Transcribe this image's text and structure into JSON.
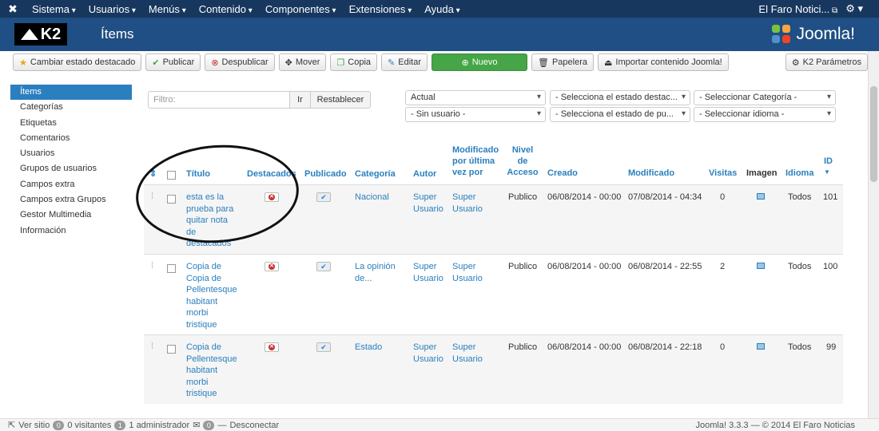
{
  "topbar": {
    "menu": [
      "Sistema",
      "Usuarios",
      "Menús",
      "Contenido",
      "Componentes",
      "Extensiones",
      "Ayuda"
    ],
    "site_name": "El Faro Notici..."
  },
  "header": {
    "logo_text": "K2",
    "title": "Ítems",
    "brand": "Joomla!"
  },
  "toolbar": {
    "featured": "Cambiar estado destacado",
    "publish": "Publicar",
    "unpublish": "Despublicar",
    "move": "Mover",
    "copy": "Copia",
    "edit": "Editar",
    "new": "Nuevo",
    "trash": "Papelera",
    "import": "Importar contenido Joomla!",
    "params": "K2 Parámetros"
  },
  "sidebar": {
    "items": [
      "Ítems",
      "Categorías",
      "Etiquetas",
      "Comentarios",
      "Usuarios",
      "Grupos de usuarios",
      "Campos extra",
      "Campos extra Grupos",
      "Gestor Multimedia",
      "Información"
    ]
  },
  "filters": {
    "search_placeholder": "Filtro:",
    "go": "Ir",
    "reset": "Restablecer",
    "state": "Actual",
    "featured_state": "- Selecciona el estado destac...",
    "category": "- Seleccionar Categoría -",
    "user": "- Sin usuario -",
    "publish_state": "- Selecciona el estado de pu...",
    "language": "- Seleccionar idioma -"
  },
  "table": {
    "headers": {
      "title": "Título",
      "featured": "Destacados",
      "published": "Publicado",
      "category": "Categoría",
      "author": "Autor",
      "modified_by_1": "Modificado",
      "modified_by_2": "por última",
      "modified_by_3": "vez por",
      "access_1": "Nivel",
      "access_2": "de",
      "access_3": "Acceso",
      "created": "Creado",
      "modified": "Modificado",
      "hits": "Visitas",
      "image": "Imagen",
      "language": "Idioma",
      "id": "ID"
    },
    "rows": [
      {
        "title": [
          "esta es la",
          "prueba para",
          "quitar nota",
          "de",
          "destacados"
        ],
        "category": [
          "Nacional",
          ""
        ],
        "author": [
          "Super",
          "Usuario"
        ],
        "modified_by": [
          "Super",
          "Usuario"
        ],
        "access": "Publico",
        "created": "06/08/2014 - 00:00",
        "modified": "07/08/2014 - 04:34",
        "hits": "0",
        "language": "Todos",
        "id": "101"
      },
      {
        "title": [
          "Copia de",
          "Copia de",
          "Pellentesque",
          "habitant",
          "morbi",
          "tristique"
        ],
        "category": [
          "La opinión",
          "de..."
        ],
        "author": [
          "Super",
          "Usuario"
        ],
        "modified_by": [
          "Super",
          "Usuario"
        ],
        "access": "Publico",
        "created": "06/08/2014 - 00:00",
        "modified": "06/08/2014 - 22:55",
        "hits": "2",
        "language": "Todos",
        "id": "100"
      },
      {
        "title": [
          "Copia de",
          "Pellentesque",
          "habitant",
          "morbi",
          "tristique"
        ],
        "category": [
          "Estado",
          ""
        ],
        "author": [
          "Super",
          "Usuario"
        ],
        "modified_by": [
          "Super",
          "Usuario"
        ],
        "access": "Publico",
        "created": "06/08/2014 - 00:00",
        "modified": "06/08/2014 - 22:18",
        "hits": "0",
        "language": "Todos",
        "id": "99"
      }
    ]
  },
  "statusbar": {
    "view_site": "Ver sitio",
    "visitors_count": "0",
    "visitors_label": "0 visitantes",
    "admins_count": "1",
    "admins_label": "1 administrador",
    "messages_count": "0",
    "logout": "Desconectar",
    "footer": "Joomla! 3.3.3 — © 2014 El Faro Noticias"
  }
}
